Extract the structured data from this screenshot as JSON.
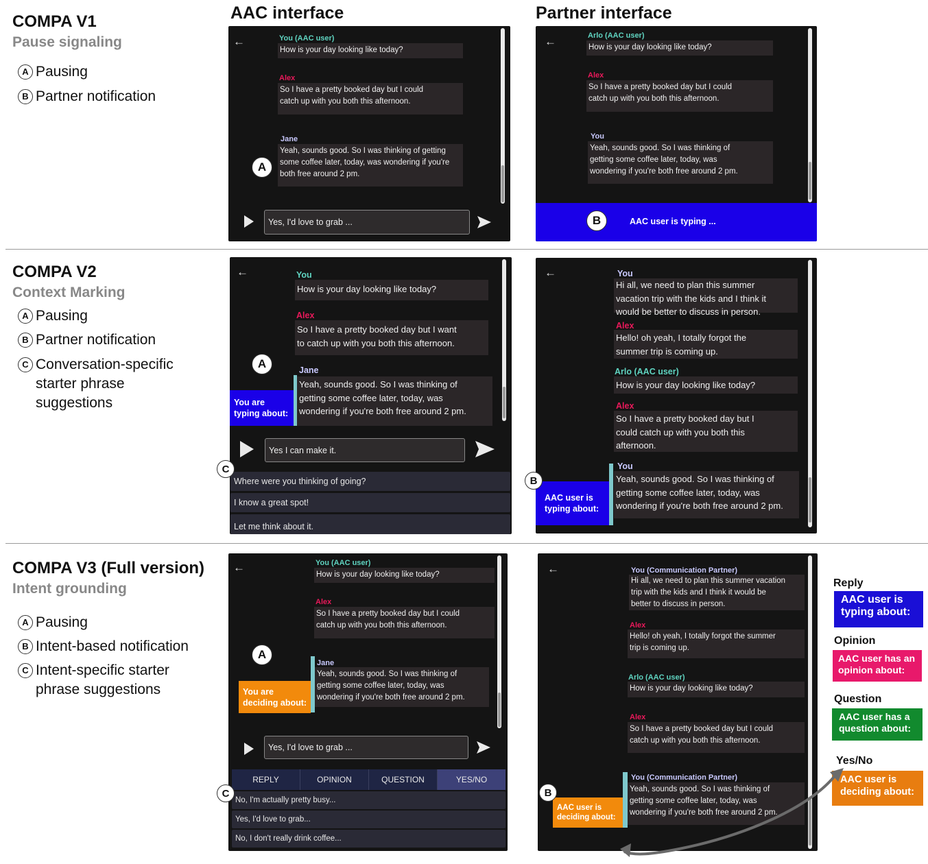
{
  "columns": {
    "aac": "AAC interface",
    "partner": "Partner  interface"
  },
  "v1": {
    "title": "COMPA V1",
    "subtitle": "Pause signaling",
    "features": [
      {
        "letter": "A",
        "text": "Pausing"
      },
      {
        "letter": "B",
        "text": "Partner notification"
      }
    ],
    "aac": {
      "msgs": [
        {
          "speaker": "You (AAC user)",
          "color": "#5fd3c0",
          "text": "How is your day looking like today?"
        },
        {
          "speaker": "Alex",
          "color": "#e8195a",
          "text": "So I have a pretty booked day but I could\ncatch up with you both this afternoon."
        },
        {
          "speaker": "Jane",
          "color": "#c9c9ff",
          "text": "Yeah, sounds good. So I was thinking of getting\nsome coffee later, today, was wondering if you're\nboth free around 2 pm."
        }
      ],
      "input": "Yes, I'd love to grab ..."
    },
    "partner": {
      "msgs": [
        {
          "speaker": "Arlo (AAC user)",
          "color": "#5fd3c0",
          "text": "How is your day looking like today?"
        },
        {
          "speaker": "Alex",
          "color": "#e8195a",
          "text": "So I have a pretty booked day but I could\ncatch up with you both this afternoon."
        },
        {
          "speaker": "You",
          "color": "#c9c9ff",
          "text": "Yeah, sounds good. So I was thinking of\ngetting some coffee later, today, was\nwondering if you're both free around 2 pm."
        }
      ],
      "banner": "AAC user is typing ..."
    }
  },
  "v2": {
    "title": "COMPA V2",
    "subtitle": "Context Marking",
    "features": [
      {
        "letter": "A",
        "text": "Pausing"
      },
      {
        "letter": "B",
        "text": "Partner notification"
      },
      {
        "letter": "C",
        "text": "Conversation-specific\nstarter phrase\nsuggestions"
      }
    ],
    "aac": {
      "msgs": [
        {
          "speaker": "You",
          "color": "#5fd3c0",
          "text": "How is your day looking like today?"
        },
        {
          "speaker": "Alex",
          "color": "#e8195a",
          "text": "So I have a pretty booked day but I want\nto catch up with you both this afternoon."
        },
        {
          "speaker": "Jane",
          "color": "#c9c9ff",
          "text": "Yeah, sounds good. So I was thinking of\ngetting some coffee later, today, was\nwondering if you're both free around 2 pm."
        }
      ],
      "context": "You are\ntyping about:",
      "input": "Yes I can make it.",
      "suggestions": [
        "Where were you thinking of going?",
        "I know a great spot!",
        "Let me think about it."
      ]
    },
    "partner": {
      "msgs": [
        {
          "speaker": "You",
          "color": "#c9c9ff",
          "text": "Hi all, we need to plan this summer\nvacation trip with the kids and I think it\nwould be better to discuss in person."
        },
        {
          "speaker": "Alex",
          "color": "#e8195a",
          "text": "Hello! oh yeah, I totally forgot the\nsummer trip is coming up."
        },
        {
          "speaker": "Arlo (AAC user)",
          "color": "#5fd3c0",
          "text": "How is your day looking like today?"
        },
        {
          "speaker": "Alex",
          "color": "#e8195a",
          "text": "So I have a pretty booked day but I\ncould catch up with you both this\nafternoon."
        },
        {
          "speaker": "You",
          "color": "#c9c9ff",
          "text": "Yeah, sounds good. So I was thinking of\ngetting some coffee later, today, was\nwondering if you're both free around 2 pm."
        }
      ],
      "context": "AAC user is\ntyping about:"
    }
  },
  "v3": {
    "title": "COMPA V3 (Full version)",
    "subtitle": "Intent grounding",
    "features": [
      {
        "letter": "A",
        "text": "Pausing"
      },
      {
        "letter": "B",
        "text": "Intent-based notification"
      },
      {
        "letter": "C",
        "text": "Intent-specific starter\nphrase suggestions"
      }
    ],
    "aac": {
      "msgs": [
        {
          "speaker": "You (AAC user)",
          "color": "#5fd3c0",
          "text": "How is your day looking like today?"
        },
        {
          "speaker": "Alex",
          "color": "#e8195a",
          "text": "So I have a pretty booked day but I could\ncatch up with you both this afternoon."
        },
        {
          "speaker": "Jane",
          "color": "#c9c9ff",
          "text": "Yeah, sounds good. So I was thinking of\ngetting some coffee later, today, was\nwondering if you're both free around 2 pm."
        }
      ],
      "context": "You are\ndeciding about:",
      "input": "Yes, I'd love to grab ...",
      "tabs": [
        "REPLY",
        "OPINION",
        "QUESTION",
        "YES/NO"
      ],
      "suggestions": [
        "No, I'm actually pretty busy...",
        "Yes, I'd love to grab...",
        "No, I don't really drink coffee..."
      ]
    },
    "partner": {
      "msgs": [
        {
          "speaker": "You (Communication Partner)",
          "color": "#c9c9ff",
          "text": "Hi all, we need to plan this summer vacation\ntrip with the kids and I think it would be\nbetter to discuss in person."
        },
        {
          "speaker": "Alex",
          "color": "#e8195a",
          "text": "Hello! oh yeah, I totally forgot the summer\ntrip is coming up."
        },
        {
          "speaker": "Arlo (AAC user)",
          "color": "#5fd3c0",
          "text": "How is your day looking like today?"
        },
        {
          "speaker": "Alex",
          "color": "#e8195a",
          "text": "So I have a pretty booked day but I could\ncatch up with you both this afternoon."
        },
        {
          "speaker": "You (Communication Partner)",
          "color": "#c9c9ff",
          "text": "Yeah, sounds good. So I was thinking of\ngetting some coffee later, today, was\nwondering if you're both free around 2 pm."
        }
      ],
      "context": "AAC user is\ndeciding about:"
    },
    "legend": [
      {
        "head": "Reply",
        "label": "AAC user is\ntyping about:",
        "color": "#1a0fd6"
      },
      {
        "head": "Opinion",
        "label": "AAC user has an\nopinion about:",
        "color": "#e8196b"
      },
      {
        "head": "Question",
        "label": "AAC user has a\nquestion about:",
        "color": "#128a2e"
      },
      {
        "head": "Yes/No",
        "label": "AAC user is\ndeciding about:",
        "color": "#e87d10"
      }
    ]
  },
  "colors": {
    "context_blue": "#1a00e8",
    "context_orange": "#f28a0c",
    "teal_bar": "#7ec8cc"
  }
}
